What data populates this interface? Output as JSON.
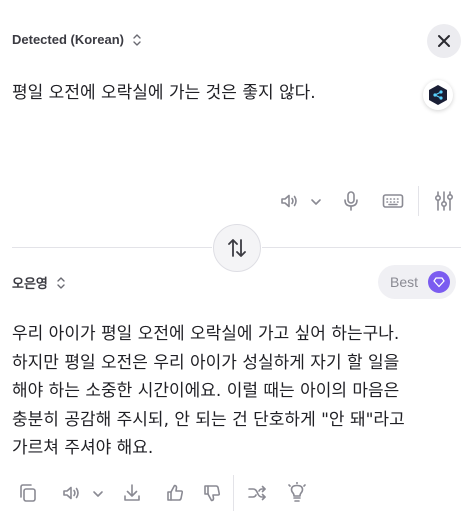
{
  "source": {
    "language_label": "Detected (Korean)",
    "text": "평일 오전에 오락실에 가는 것은 좋지 않다."
  },
  "target": {
    "language_label": "오은영",
    "best_label": "Best",
    "text_lines": [
      "우리 아이가 평일 오전에 오락실에 가고 싶어 하는구나.",
      "하지만 평일 오전은 우리 아이가 성실하게 자기 할 일을",
      "해야 하는 소중한 시간이에요. 이럴 때는 아이의 마음은",
      "충분히 공감해 주시되, 안 되는 건 단호하게 \"안 돼\"라고",
      "가르쳐 주셔야 해요."
    ]
  },
  "colors": {
    "accent": "#7b5cf0",
    "brand": "#1a1f36",
    "divider": "#e3e3e8",
    "icon": "#8a8a93"
  },
  "icons": {
    "source_toolbar": [
      "speaker-icon",
      "chevron-down-icon",
      "microphone-icon",
      "keyboard-icon",
      "sliders-icon"
    ],
    "target_toolbar": [
      "copy-icon",
      "speaker-icon",
      "chevron-down-icon",
      "download-icon",
      "thumbs-up-icon",
      "thumbs-down-icon",
      "shuffle-icon",
      "lightbulb-icon"
    ]
  }
}
